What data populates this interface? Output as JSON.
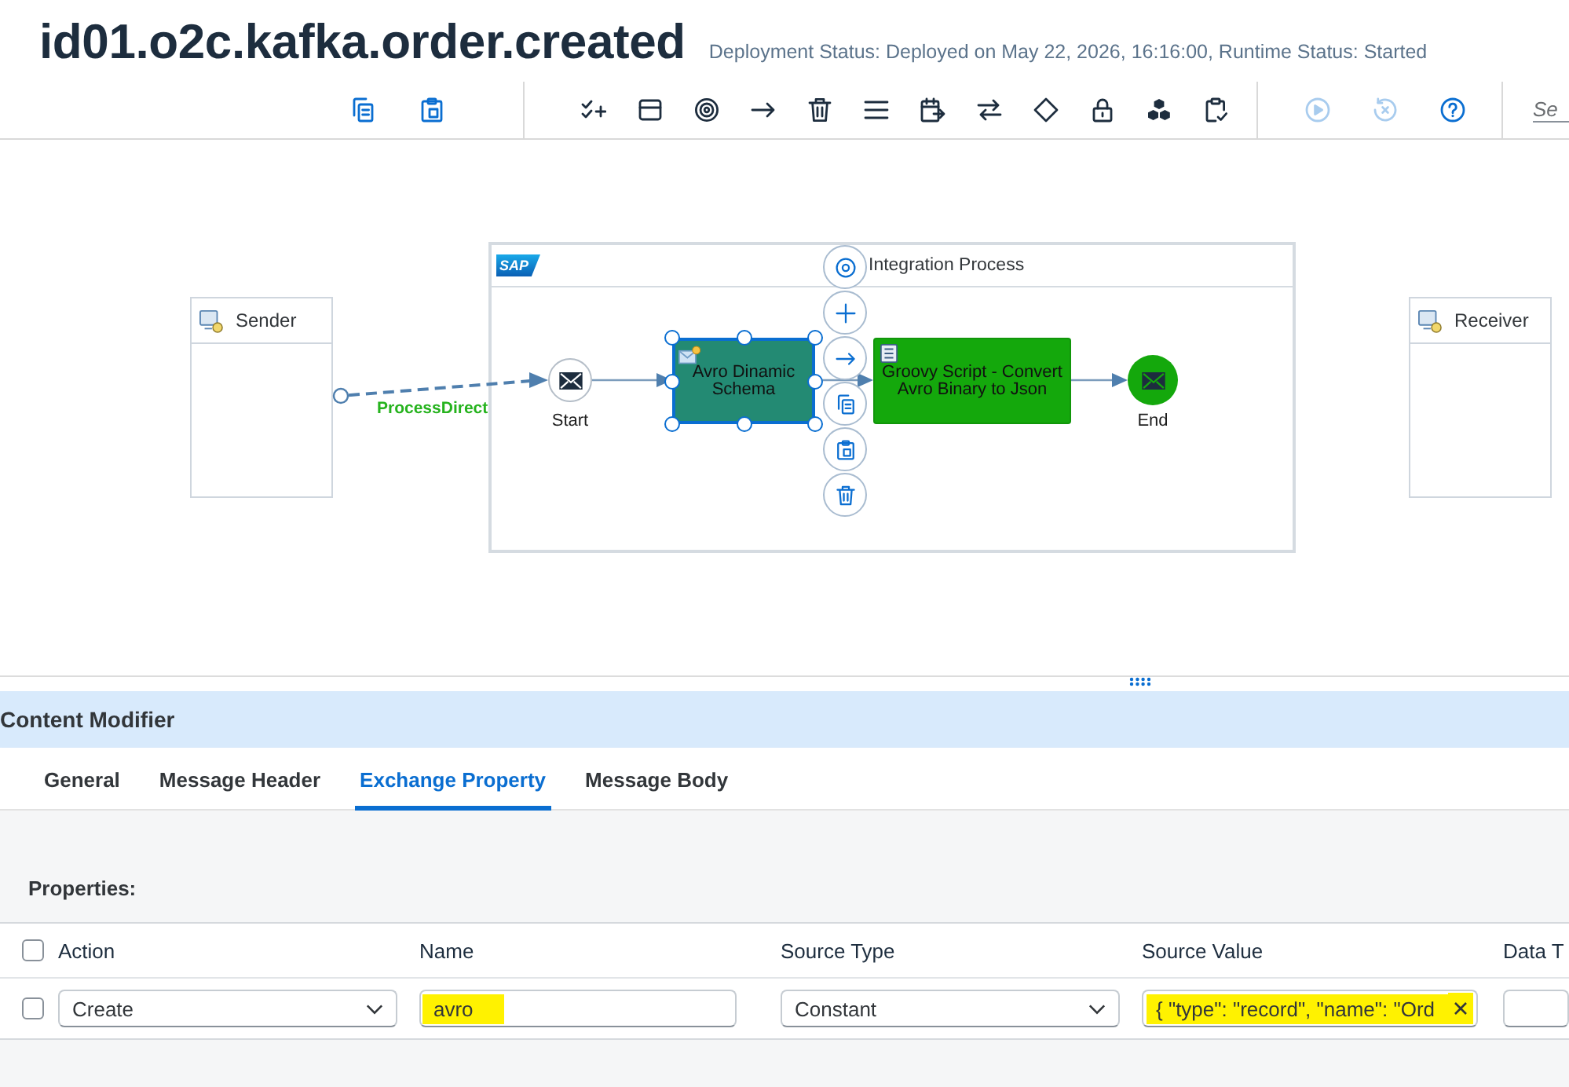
{
  "header": {
    "title": "id01.o2c.kafka.order.created",
    "status": "Deployment Status: Deployed on May 22, 2026, 16:16:00, Runtime Status: Started"
  },
  "toolbar": {
    "groups": [
      {
        "items": [
          {
            "kind": "copy",
            "disabled": false
          },
          {
            "kind": "paste",
            "disabled": false
          }
        ]
      },
      {
        "items": [
          {
            "kind": "check-plus",
            "disabled": false
          },
          {
            "kind": "window",
            "disabled": false
          },
          {
            "kind": "target",
            "disabled": false
          },
          {
            "kind": "arrow",
            "disabled": false
          },
          {
            "kind": "delete",
            "disabled": false
          },
          {
            "kind": "lines",
            "disabled": false
          },
          {
            "kind": "calendar-arrow",
            "disabled": false
          },
          {
            "kind": "swap",
            "disabled": false
          },
          {
            "kind": "diamond",
            "disabled": false
          },
          {
            "kind": "lock",
            "disabled": false
          },
          {
            "kind": "cubes",
            "disabled": false
          },
          {
            "kind": "clipboard-check",
            "disabled": false
          }
        ]
      },
      {
        "items": [
          {
            "kind": "play",
            "disabled": true
          },
          {
            "kind": "reset",
            "disabled": true
          },
          {
            "kind": "help",
            "disabled": false
          }
        ]
      }
    ],
    "search": {
      "placeholder": "Se"
    }
  },
  "diagram": {
    "participants": [
      {
        "label": "Sender"
      },
      {
        "label": "Receiver"
      }
    ],
    "channel": {
      "label": "ProcessDirect"
    },
    "process": {
      "logo": "SAP",
      "title": "Integration Process",
      "steps": [
        {
          "kind": "start",
          "label": "Start",
          "selected": false
        },
        {
          "kind": "task",
          "label": "Avro Dinamic Schema",
          "selected": true,
          "color": "#238a73"
        },
        {
          "kind": "script",
          "label": "Groovy Script - Convert Avro Binary to Json",
          "selected": false,
          "color": "#14a80c"
        },
        {
          "kind": "end",
          "label": "End",
          "selected": false
        }
      ]
    },
    "quick_actions": [
      {
        "kind": "ring"
      },
      {
        "kind": "add"
      },
      {
        "kind": "connect"
      },
      {
        "kind": "copy"
      },
      {
        "kind": "paste"
      },
      {
        "kind": "delete"
      }
    ]
  },
  "panel": {
    "title": "Content Modifier",
    "tabs": [
      {
        "label": "General",
        "selected": false
      },
      {
        "label": "Message Header",
        "selected": false
      },
      {
        "label": "Exchange Property",
        "selected": true
      },
      {
        "label": "Message Body",
        "selected": false
      }
    ],
    "section": "Properties:",
    "table": {
      "select_all": {
        "checked": false
      },
      "columns": [
        "Action",
        "Name",
        "Source Type",
        "Source Value",
        "Data T"
      ],
      "rows": [
        {
          "checked": false,
          "cells": [
            {
              "kind": "dropdown",
              "value": "Create"
            },
            {
              "kind": "text",
              "value": "avro",
              "highlighted": true
            },
            {
              "kind": "dropdown",
              "value": "Constant"
            },
            {
              "kind": "text",
              "value": "{ \"type\": \"record\", \"name\": \"Ord",
              "highlighted": true,
              "clearable": true
            },
            {
              "kind": "text"
            }
          ]
        }
      ]
    }
  }
}
